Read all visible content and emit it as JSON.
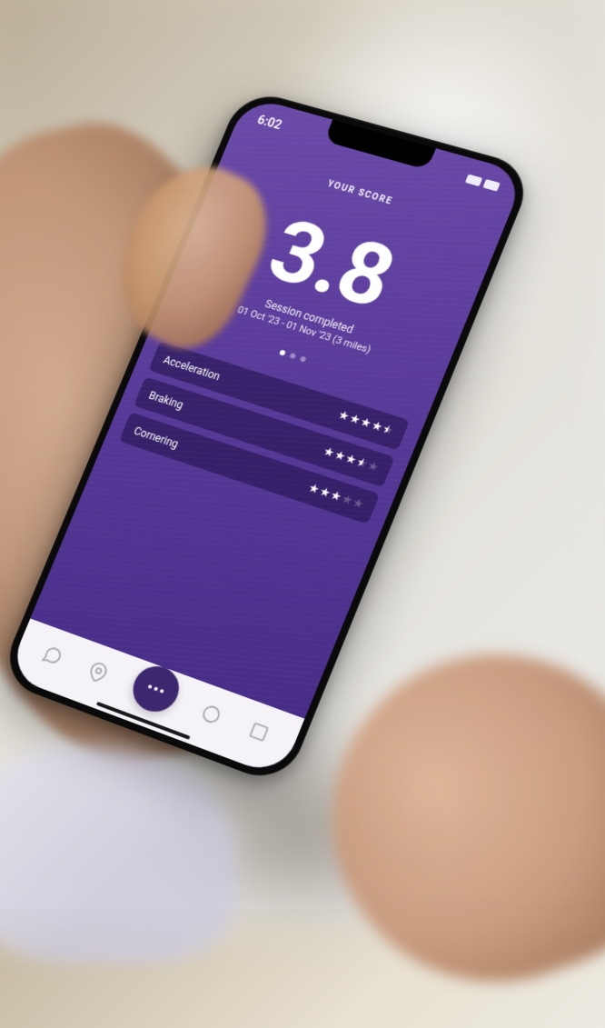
{
  "status_bar": {
    "time": "6:02"
  },
  "header": {
    "label": "YOUR SCORE"
  },
  "score": {
    "value": "3.8",
    "session_label": "Session completed",
    "session_range": "01 Oct '23 - 01 Nov '23 (3 miles)"
  },
  "metrics": [
    {
      "label": "Acceleration",
      "rating": 4.5
    },
    {
      "label": "Braking",
      "rating": 3.5
    },
    {
      "label": "Cornering",
      "rating": 3.0
    }
  ],
  "nav": {
    "items": [
      "chat",
      "location",
      "more",
      "item4",
      "item5"
    ]
  },
  "colors": {
    "primary": "#5c3d9c",
    "dark": "#3d2870"
  }
}
